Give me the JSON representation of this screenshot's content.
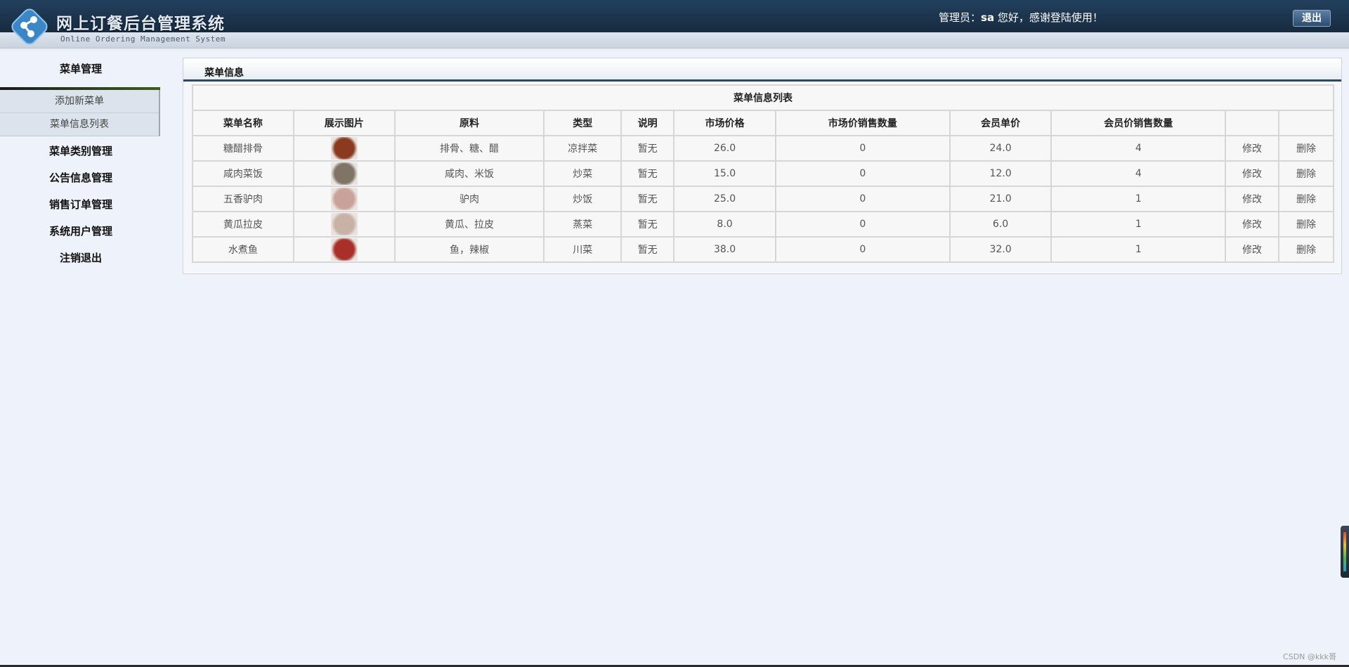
{
  "header": {
    "title": "网上订餐后台管理系统",
    "subtitle": "Online Ordering Management System",
    "welcome_prefix": "管理员：",
    "user": "sa",
    "welcome_suffix": " 您好，感谢登陆使用！",
    "logout_label": "退出"
  },
  "sidebar": {
    "section_title": "菜单管理",
    "sub_items": [
      {
        "label": "添加新菜单"
      },
      {
        "label": "菜单信息列表"
      }
    ],
    "items": [
      {
        "label": "菜单类别管理"
      },
      {
        "label": "公告信息管理"
      },
      {
        "label": "销售订单管理"
      },
      {
        "label": "系统用户管理"
      },
      {
        "label": "注销退出"
      }
    ]
  },
  "main": {
    "panel_title": "菜单信息",
    "table_caption": "菜单信息列表",
    "columns": [
      "菜单名称",
      "展示图片",
      "原料",
      "类型",
      "说明",
      "市场价格",
      "市场价销售数量",
      "会员单价",
      "会员价销售数量",
      "",
      ""
    ],
    "rows": [
      {
        "name": "糖醋排骨",
        "ingredients": "排骨、糖、醋",
        "type": "凉拌菜",
        "note": "暂无",
        "market_price": "26.0",
        "market_sales": "0",
        "member_price": "24.0",
        "member_sales": "4",
        "edit": "修改",
        "delete": "删除",
        "img_color": "#8a3a1e"
      },
      {
        "name": "咸肉菜饭",
        "ingredients": "咸肉、米饭",
        "type": "炒菜",
        "note": "暂无",
        "market_price": "15.0",
        "market_sales": "0",
        "member_price": "12.0",
        "member_sales": "4",
        "edit": "修改",
        "delete": "删除",
        "img_color": "#7f7466"
      },
      {
        "name": "五香驴肉",
        "ingredients": "驴肉",
        "type": "炒饭",
        "note": "暂无",
        "market_price": "25.0",
        "market_sales": "0",
        "member_price": "21.0",
        "member_sales": "1",
        "edit": "修改",
        "delete": "删除",
        "img_color": "#c9a39a"
      },
      {
        "name": "黄瓜拉皮",
        "ingredients": "黄瓜、拉皮",
        "type": "蒸菜",
        "note": "暂无",
        "market_price": "8.0",
        "market_sales": "0",
        "member_price": "6.0",
        "member_sales": "1",
        "edit": "修改",
        "delete": "删除",
        "img_color": "#c8b2a6"
      },
      {
        "name": "水煮鱼",
        "ingredients": "鱼，辣椒",
        "type": "川菜",
        "note": "暂无",
        "market_price": "38.0",
        "market_sales": "0",
        "member_price": "32.0",
        "member_sales": "1",
        "edit": "修改",
        "delete": "删除",
        "img_color": "#a9302a"
      }
    ]
  },
  "watermark": "CSDN @kkk哥"
}
